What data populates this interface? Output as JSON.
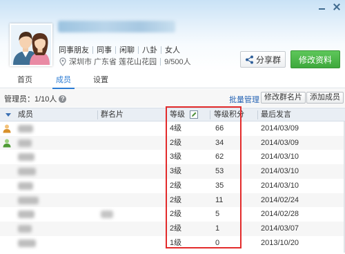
{
  "window": {
    "minimize_glyph": "—",
    "close_glyph": "✕"
  },
  "group": {
    "tags": [
      "同事朋友",
      "同事",
      "闲聊",
      "八卦",
      "女人"
    ],
    "location": "深圳市 广东省 莲花山花园",
    "members_count": "9/500人"
  },
  "actions": {
    "share_label": "分享群",
    "edit_label": "修改资料"
  },
  "tabs": [
    {
      "label": "首页",
      "active": false
    },
    {
      "label": "成员",
      "active": true
    },
    {
      "label": "设置",
      "active": false
    }
  ],
  "toolbar": {
    "admin_label": "管理员：1/10人",
    "help_glyph": "?",
    "batch_label": "批量管理",
    "edit_card_label": "修改群名片",
    "add_member_label": "添加成员"
  },
  "table": {
    "headers": {
      "member": "成员",
      "card": "群名片",
      "level": "等级",
      "points": "等级积分",
      "last_speak": "最后发言"
    },
    "rows": [
      {
        "role": "owner",
        "level": "4级",
        "points": "66",
        "last": "2014/03/09"
      },
      {
        "role": "admin",
        "level": "2级",
        "points": "34",
        "last": "2014/03/09"
      },
      {
        "role": "",
        "level": "3级",
        "points": "62",
        "last": "2014/03/10"
      },
      {
        "role": "",
        "level": "3级",
        "points": "53",
        "last": "2014/03/10"
      },
      {
        "role": "",
        "level": "2级",
        "points": "35",
        "last": "2014/03/10"
      },
      {
        "role": "",
        "level": "2级",
        "points": "11",
        "last": "2014/02/24"
      },
      {
        "role": "",
        "level": "2级",
        "points": "5",
        "last": "2014/02/28"
      },
      {
        "role": "",
        "level": "2级",
        "points": "1",
        "last": "2014/03/07"
      },
      {
        "role": "",
        "level": "1级",
        "points": "0",
        "last": "2013/10/20"
      }
    ]
  },
  "colors": {
    "accent": "#2b7bd3",
    "green": "#3ea83c",
    "highlight": "#e32a2a"
  }
}
